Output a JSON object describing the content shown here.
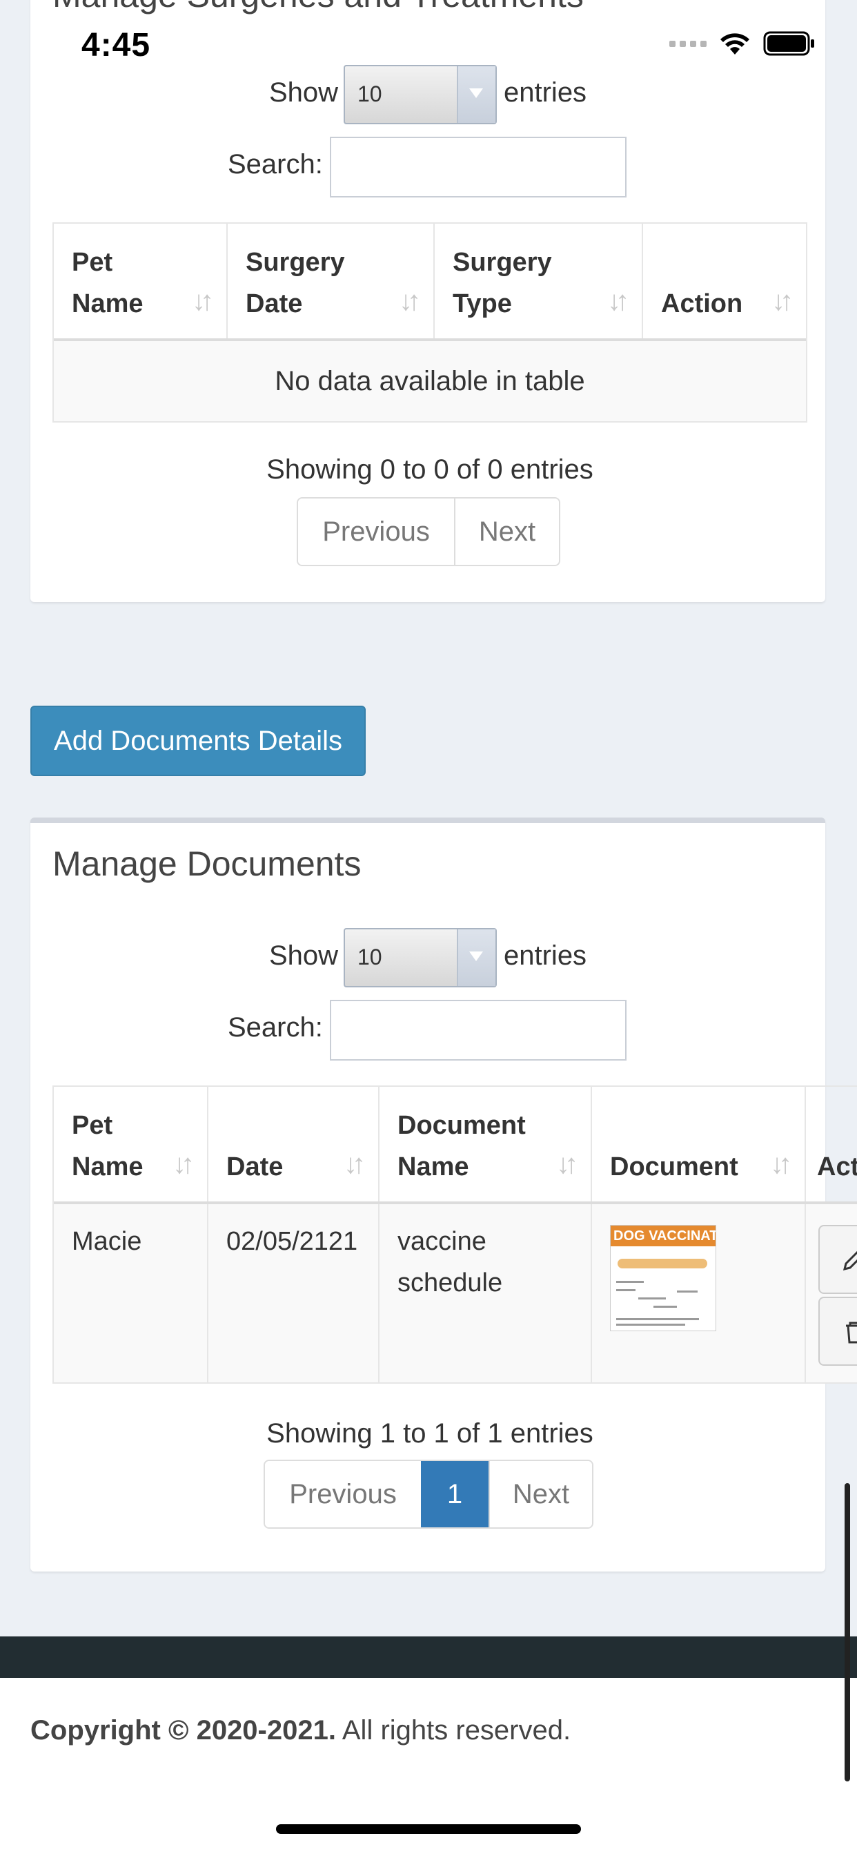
{
  "status_bar": {
    "time": "4:45"
  },
  "surgeries": {
    "title": "Manage Surgeries and Treatments",
    "show_label": "Show",
    "entries_label": "entries",
    "page_size": "10",
    "search_label": "Search:",
    "search_value": "",
    "columns": [
      {
        "line1": "Pet",
        "line2": "Name"
      },
      {
        "line1": "Surgery",
        "line2": "Date"
      },
      {
        "line1": "Surgery",
        "line2": "Type"
      },
      {
        "line1": "",
        "line2": "Action"
      }
    ],
    "empty_message": "No data available in table",
    "info": "Showing 0 to 0 of 0 entries",
    "prev": "Previous",
    "next": "Next"
  },
  "add_documents_button": "Add Documents Details",
  "documents": {
    "title": "Manage Documents",
    "show_label": "Show",
    "entries_label": "entries",
    "page_size": "10",
    "search_label": "Search:",
    "search_value": "",
    "columns": [
      {
        "line1": "Pet",
        "line2": "Name"
      },
      {
        "line1": "",
        "line2": "Date"
      },
      {
        "line1": "Document",
        "line2": "Name"
      },
      {
        "line1": "",
        "line2": "Document"
      },
      {
        "line1": "",
        "line2": "Act"
      }
    ],
    "rows": [
      {
        "pet_name": "Macie",
        "date": "02/05/2121",
        "doc_name_1": "vaccine",
        "doc_name_2": "schedule",
        "thumb_title": "DOG VACCINATION CHART"
      }
    ],
    "info": "Showing 1 to 1 of 1 entries",
    "prev": "Previous",
    "page": "1",
    "next": "Next"
  },
  "footer": {
    "copyright_bold": "Copyright © 2020-2021.",
    "copyright_rest": " All rights reserved."
  },
  "colors": {
    "primary": "#3c8dbc",
    "page_active": "#337ab7",
    "footer_dark": "#222d32",
    "background": "#ecf0f5"
  }
}
